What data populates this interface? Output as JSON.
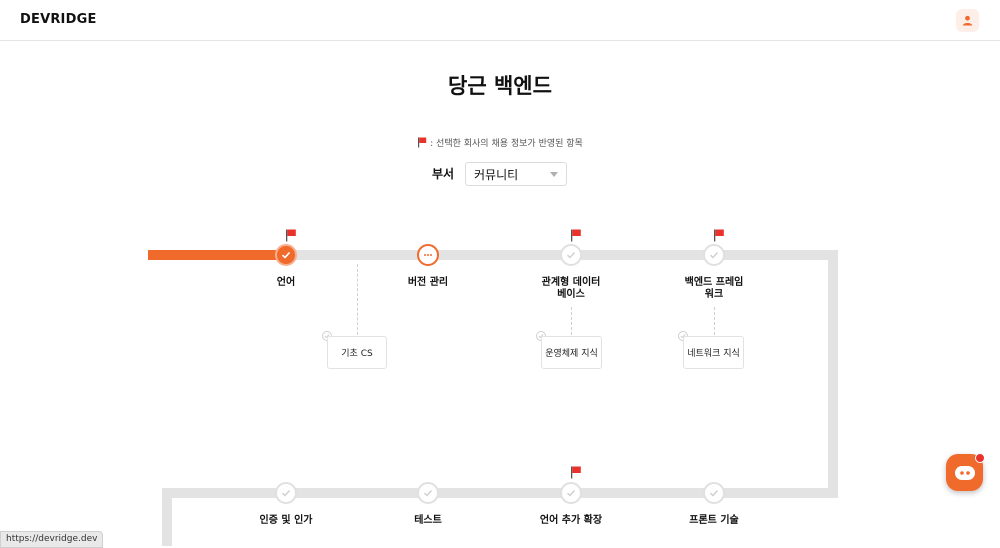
{
  "header": {
    "logo": "DEVRIDGE",
    "profile_icon": "user-icon"
  },
  "page": {
    "title": "당근 백엔드"
  },
  "legend": {
    "text": ": 선택한 회사의 채용 정보가 반영된 항목",
    "flag_color": "#e8322b"
  },
  "department": {
    "label": "부서",
    "selected": "커뮤니티"
  },
  "colors": {
    "accent": "#f06a2b",
    "track": "#e3e3e3",
    "flag": "#e8322b"
  },
  "roadmap": {
    "row1": [
      {
        "label": "언어",
        "status": "done",
        "flag": true
      },
      {
        "label": "버전 관리",
        "status": "current",
        "flag": false
      },
      {
        "label_line1": "관계형 데이터",
        "label_line2": "베이스",
        "status": "pending",
        "flag": true
      },
      {
        "label_line1": "백엔드 프레임",
        "label_line2": "워크",
        "status": "pending",
        "flag": true
      }
    ],
    "subs": [
      {
        "label": "기초 CS"
      },
      {
        "label": "운영체제 지식"
      },
      {
        "label": "네트워크 지식"
      }
    ],
    "row2": [
      {
        "label": "인증 및 인가",
        "status": "pending",
        "flag": false
      },
      {
        "label": "테스트",
        "status": "pending",
        "flag": false
      },
      {
        "label": "언어 추가 확장",
        "status": "pending",
        "flag": true
      },
      {
        "label": "프론트 기술",
        "status": "pending",
        "flag": false
      }
    ]
  },
  "chat": {
    "icon": "chat-bot-icon"
  },
  "status_bar": {
    "url": "https://devridge.dev"
  }
}
